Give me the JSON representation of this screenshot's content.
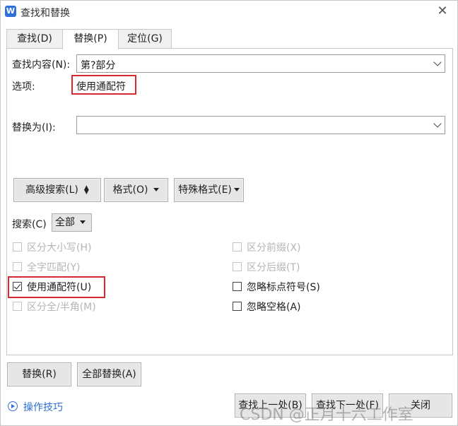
{
  "window": {
    "title": "查找和替换",
    "app_icon_letter": "W",
    "close_glyph": "✕"
  },
  "tabs": [
    {
      "label": "查找(D)",
      "active": false
    },
    {
      "label": "替换(P)",
      "active": true
    },
    {
      "label": "定位(G)",
      "active": false
    }
  ],
  "find": {
    "label": "查找内容(N):",
    "value": "第?部分"
  },
  "options": {
    "label": "选项:",
    "value": "使用通配符"
  },
  "replace": {
    "label": "替换为(I):",
    "value": ""
  },
  "buttons": {
    "advanced": "高级搜索(L)",
    "format": "格式(O)",
    "special": "特殊格式(E)"
  },
  "search": {
    "label": "搜索(C)",
    "value": "全部"
  },
  "checkboxes": {
    "left": [
      {
        "label": "区分大小写(H)",
        "checked": false,
        "enabled": false
      },
      {
        "label": "全字匹配(Y)",
        "checked": false,
        "enabled": false
      },
      {
        "label": "使用通配符(U)",
        "checked": true,
        "enabled": true
      },
      {
        "label": "区分全/半角(M)",
        "checked": false,
        "enabled": false
      }
    ],
    "right": [
      {
        "label": "区分前缀(X)",
        "checked": false,
        "enabled": false
      },
      {
        "label": "区分后缀(T)",
        "checked": false,
        "enabled": false
      },
      {
        "label": "忽略标点符号(S)",
        "checked": false,
        "enabled": true
      },
      {
        "label": "忽略空格(A)",
        "checked": false,
        "enabled": true
      }
    ]
  },
  "actions": {
    "replace": "替换(R)",
    "replace_all": "全部替换(A)",
    "find_prev": "查找上一处(B)",
    "find_next": "查找下一处(F)",
    "close": "关闭"
  },
  "tips": {
    "label": "操作技巧"
  },
  "watermark": "CSDN @正月十六工作室",
  "colors": {
    "highlight": "#d9282f",
    "link": "#2c6ed5",
    "app_icon": "#2f6fd8"
  }
}
